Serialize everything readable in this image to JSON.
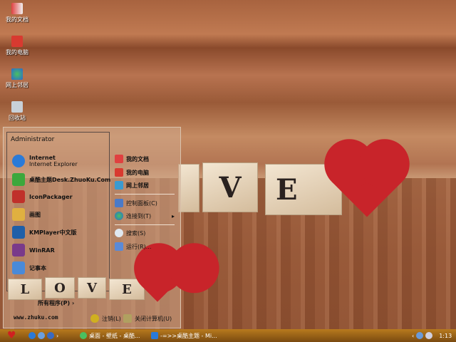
{
  "desktop_icons": [
    {
      "label": "我的文档",
      "icon": "my-documents-icon"
    },
    {
      "label": "我的电脑",
      "icon": "my-computer-icon"
    },
    {
      "label": "网上邻居",
      "icon": "network-icon"
    },
    {
      "label": "回收站",
      "icon": "recycle-bin-icon"
    }
  ],
  "wallpaper": {
    "blocks": [
      "V",
      "E"
    ],
    "menu_blocks": [
      "L",
      "O",
      "V",
      "E"
    ]
  },
  "start_menu": {
    "user": "Administrator",
    "left_items": [
      {
        "label": "Internet",
        "sub": "Internet Explorer",
        "color": "#2a7ad8"
      },
      {
        "label": "桌酷主题Desk.ZhuoKu.Com",
        "color": "#3ca83c"
      },
      {
        "label": "IconPackager",
        "color": "#c0302a"
      },
      {
        "label": "画图",
        "color": "#e0b040"
      },
      {
        "label": "KMPlayer中文版",
        "color": "#1f5fa8"
      },
      {
        "label": "WinRAR",
        "color": "#7a3a8a"
      },
      {
        "label": "记事本",
        "color": "#4a8ad8"
      }
    ],
    "all_programs": "所有程序(P)",
    "right_items": [
      {
        "label": "我的文档"
      },
      {
        "label": "我的电脑"
      },
      {
        "label": "网上邻居"
      },
      {
        "label": "控制面板(C)"
      },
      {
        "label": "连接到(T)",
        "arrow": "▸"
      },
      {
        "label": "搜索(S)"
      },
      {
        "label": "运行(R)..."
      }
    ],
    "website": "www.zhuku.com",
    "logoff": "注销(L)",
    "shutdown": "关闭计算机(U)"
  },
  "taskbar": {
    "items": [
      "桌面 - 壁纸 - 桌酷...",
      "-=>>桌酷主题 - Mi..."
    ],
    "clock": "1:13",
    "chevron": "›",
    "tray_chevron": "‹"
  }
}
